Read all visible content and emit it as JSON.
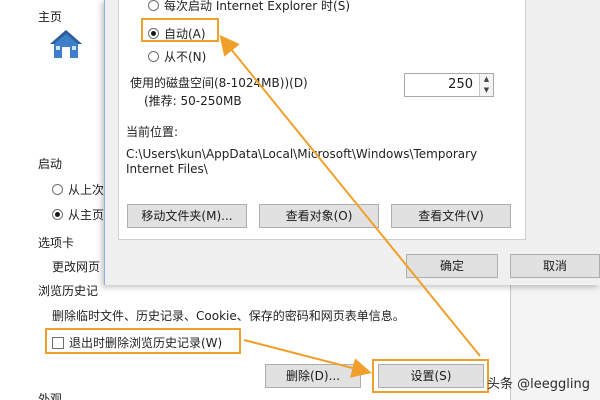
{
  "background_dialog": {
    "sections": {
      "home": "主页",
      "startup": "启动",
      "tabs": "选项卡",
      "history": "浏览历史记"
    },
    "startup_options": [
      {
        "label": "从上次",
        "checked": false
      },
      {
        "label": "从主页",
        "checked": true
      }
    ],
    "tabs_text": "更改网页",
    "history_description": "删除临时文件、历史记录、Cookie、保存的密码和网页表单信息。",
    "delete_on_exit_label": "退出时删除浏览历史记录(W)",
    "delete_button": "删除(D)...",
    "settings_button": "设置(S)",
    "bottom_cut_label": "外观"
  },
  "foreground_dialog": {
    "check_options": [
      {
        "label": "每次启动 Internet Explorer 时(S)",
        "checked": false
      },
      {
        "label": "自动(A)",
        "checked": true
      },
      {
        "label": "从不(N)",
        "checked": false
      }
    ],
    "disk_space_label": "使用的磁盘空间(8-1024MB))(D)",
    "recommended_label": "(推荐: 50-250MB",
    "disk_space_value": "250",
    "current_location_label": "当前位置:",
    "current_location_path_1": "C:\\Users\\kun\\AppData\\Local\\Microsoft\\Windows\\Temporary",
    "current_location_path_2": "Internet Files\\",
    "move_folder_button": "移动文件夹(M)...",
    "view_objects_button": "查看对象(O)",
    "view_files_button": "查看文件(V)",
    "ok_button": "确定",
    "cancel_button": "取消"
  },
  "watermark": "头条 @leeggling",
  "colors": {
    "highlight": "#f0a02a",
    "dialog_bg": "#f0f0f0",
    "button_bg": "#e1e1e1"
  }
}
